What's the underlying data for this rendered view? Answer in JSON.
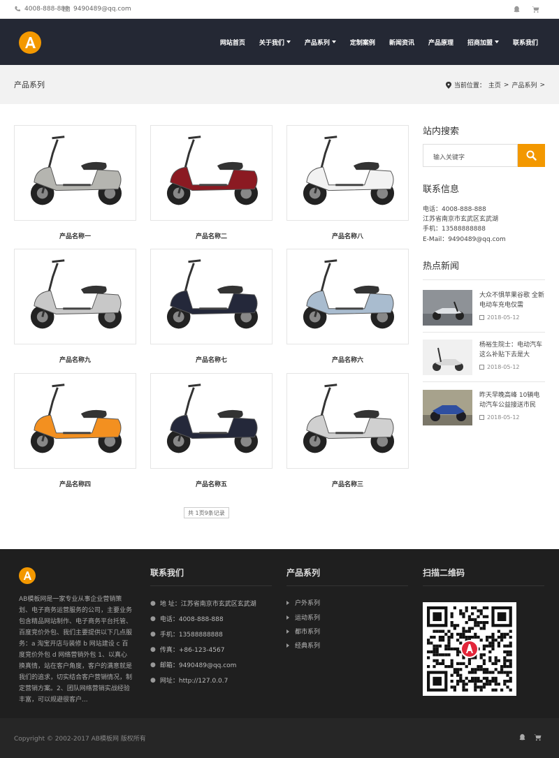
{
  "topbar": {
    "phone": "4008-888-888",
    "email": "9490489@qq.com"
  },
  "nav": {
    "items": [
      {
        "label": "网站首页",
        "has_dropdown": false
      },
      {
        "label": "关于我们",
        "has_dropdown": true
      },
      {
        "label": "产品系列",
        "has_dropdown": true
      },
      {
        "label": "定制案例",
        "has_dropdown": false
      },
      {
        "label": "新闻资讯",
        "has_dropdown": false
      },
      {
        "label": "产品原理",
        "has_dropdown": false
      },
      {
        "label": "招商加盟",
        "has_dropdown": true
      },
      {
        "label": "联系我们",
        "has_dropdown": false
      }
    ]
  },
  "banner": {
    "title": "产品系列",
    "crumb_prefix": "当前位置：",
    "crumb_home": "主页",
    "crumb_sep": ">",
    "crumb_current": "产品系列",
    "crumb_tail": ">"
  },
  "products": [
    {
      "name": "产品名称一",
      "color": "#b5b5b0"
    },
    {
      "name": "产品名称二",
      "color": "#8b1a22"
    },
    {
      "name": "产品名称八",
      "color": "#f2f2f2"
    },
    {
      "name": "产品名称九",
      "color": "#c8c8c8"
    },
    {
      "name": "产品名称七",
      "color": "#24283a"
    },
    {
      "name": "产品名称六",
      "color": "#a9bccf"
    },
    {
      "name": "产品名称四",
      "color": "#f39020"
    },
    {
      "name": "产品名称五",
      "color": "#24283a"
    },
    {
      "name": "产品名称三",
      "color": "#d0d0d0"
    }
  ],
  "pager": {
    "text": "共 1页9条记录"
  },
  "sidebar": {
    "search_heading": "站内搜索",
    "search_placeholder": "输入关键字",
    "contact_heading": "联系信息",
    "contact_lines": [
      "电话：4008-888-888",
      "江苏省南京市玄武区玄武湖",
      "手机：13588888888",
      "E-Mail：9490489@qq.com"
    ],
    "news_heading": "热点新闻",
    "news": [
      {
        "title": "大众不惧苹果谷歌 全新电动车充电仅需",
        "date": "2018-05-12"
      },
      {
        "title": "杨裕生院士：电动汽车这么补贴下去是大",
        "date": "2018-05-12"
      },
      {
        "title": "昨天早晚高峰 10辆电动汽车公益接送市民",
        "date": "2018-05-12"
      }
    ]
  },
  "footer": {
    "description": "AB模板网是一家专业从事企业营销策划、电子商务运营服务的公司，主要业务包含精品网站制作、电子商务平台托管、百度竞价外包、我们主要提供以下几点服务：a 淘宝开店与装修 b 网站建设 c 百度竞价外包 d 网络营销外包 1、以真心换真情，站在客户角度，客户的满意就是我们的追求，切实结合客户营销情况，制定营销方案。2、团队网络营销实战经验丰富，可以规避很客户...",
    "contact_heading": "联系我们",
    "contact": [
      {
        "icon": "map-marker-icon",
        "text": "地 址：江苏省南京市玄武区玄武湖"
      },
      {
        "icon": "globe-icon",
        "text": "电话：4008-888-888"
      },
      {
        "icon": "phone-icon",
        "text": "手机：13588888888"
      },
      {
        "icon": "fax-icon",
        "text": "传真：+86-123-4567"
      },
      {
        "icon": "envelope-icon",
        "text": "邮箱：9490489@qq.com"
      },
      {
        "icon": "home-icon",
        "text": "网址：http://127.0.0.7"
      }
    ],
    "categories_heading": "产品系列",
    "categories": [
      "户外系列",
      "运动系列",
      "都市系列",
      "经典系列"
    ],
    "qr_heading": "扫描二维码",
    "copyright": "Copyright © 2002-2017 AB模板网 版权所有"
  },
  "colors": {
    "accent": "#f39800",
    "header_bg": "#242834",
    "footer_bg": "#1f1f1f"
  }
}
